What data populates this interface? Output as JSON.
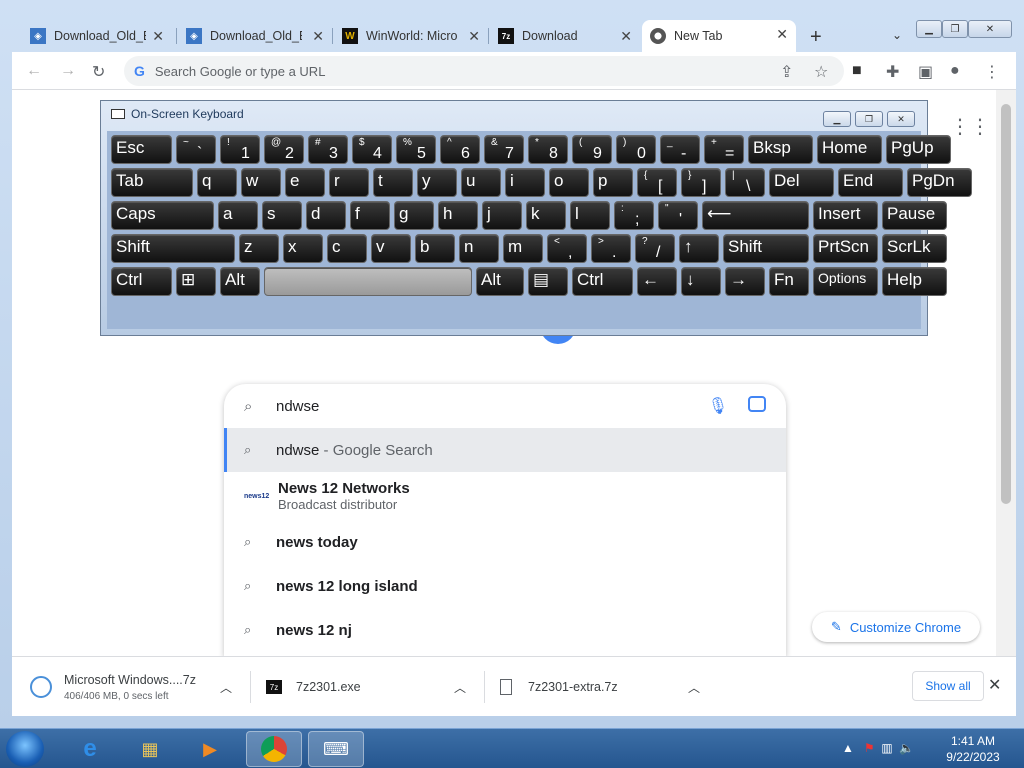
{
  "browser": {
    "tabs": [
      {
        "title": "Download_Old_B",
        "favicon": "globe-doc-icon"
      },
      {
        "title": "Download_Old_B",
        "favicon": "globe-doc-icon"
      },
      {
        "title": "WinWorld: Micro",
        "favicon": "winworld-w-icon"
      },
      {
        "title": "Download",
        "favicon": "7zip-icon"
      },
      {
        "title": "New Tab",
        "favicon": "chrome-icon"
      }
    ],
    "omnibox_placeholder": "Search Google or type a URL"
  },
  "osk": {
    "title": "On-Screen Keyboard",
    "rows": [
      [
        {
          "l": "Esc"
        },
        {
          "t": "~",
          "b": "`"
        },
        {
          "t": "!",
          "b": "1"
        },
        {
          "t": "@",
          "b": "2"
        },
        {
          "t": "#",
          "b": "3"
        },
        {
          "t": "$",
          "b": "4"
        },
        {
          "t": "%",
          "b": "5"
        },
        {
          "t": "^",
          "b": "6"
        },
        {
          "t": "&",
          "b": "7"
        },
        {
          "t": "*",
          "b": "8"
        },
        {
          "t": "(",
          "b": "9"
        },
        {
          "t": ")",
          "b": "0"
        },
        {
          "t": "_",
          "b": "-"
        },
        {
          "t": "+",
          "b": "="
        },
        {
          "l": "Bksp"
        },
        {
          "l": "Home"
        },
        {
          "l": "PgUp"
        }
      ],
      [
        {
          "l": "Tab"
        },
        {
          "l": "q"
        },
        {
          "l": "w"
        },
        {
          "l": "e"
        },
        {
          "l": "r"
        },
        {
          "l": "t"
        },
        {
          "l": "y"
        },
        {
          "l": "u"
        },
        {
          "l": "i"
        },
        {
          "l": "o"
        },
        {
          "l": "p"
        },
        {
          "t": "{",
          "b": "["
        },
        {
          "t": "}",
          "b": "]"
        },
        {
          "t": "|",
          "b": "\\"
        },
        {
          "l": "Del"
        },
        {
          "l": "End"
        },
        {
          "l": "PgDn"
        }
      ],
      [
        {
          "l": "Caps"
        },
        {
          "l": "a"
        },
        {
          "l": "s"
        },
        {
          "l": "d"
        },
        {
          "l": "f"
        },
        {
          "l": "g"
        },
        {
          "l": "h"
        },
        {
          "l": "j"
        },
        {
          "l": "k"
        },
        {
          "l": "l"
        },
        {
          "t": ":",
          "b": ";"
        },
        {
          "t": "\"",
          "b": "'"
        },
        {
          "l": "⟵"
        },
        {
          "l": "Insert"
        },
        {
          "l": "Pause"
        }
      ],
      [
        {
          "l": "Shift"
        },
        {
          "l": "z"
        },
        {
          "l": "x"
        },
        {
          "l": "c"
        },
        {
          "l": "v"
        },
        {
          "l": "b"
        },
        {
          "l": "n"
        },
        {
          "l": "m"
        },
        {
          "t": "<",
          "b": ","
        },
        {
          "t": ">",
          "b": "."
        },
        {
          "t": "?",
          "b": "/"
        },
        {
          "l": "↑"
        },
        {
          "l": "Shift"
        },
        {
          "l": "PrtScn"
        },
        {
          "l": "ScrLk"
        }
      ],
      [
        {
          "l": "Ctrl"
        },
        {
          "l": "⊞"
        },
        {
          "l": "Alt"
        },
        {
          "l": ""
        },
        {
          "l": "Alt"
        },
        {
          "l": "▤"
        },
        {
          "l": "Ctrl"
        },
        {
          "l": "←"
        },
        {
          "l": "↓"
        },
        {
          "l": "→"
        },
        {
          "l": "Fn"
        },
        {
          "l": "Options"
        },
        {
          "l": "Help"
        }
      ]
    ]
  },
  "search": {
    "query": "ndwse",
    "suggestions": [
      {
        "bold": "ndwse",
        "rest": " - Google Search",
        "icon": "search-icon"
      },
      {
        "bold": "News 12 Networks",
        "sub": "Broadcast distributor",
        "icon": "news12-logo"
      },
      {
        "bold": "news today",
        "icon": "search-icon"
      },
      {
        "bold": "news 12 long island",
        "icon": "search-icon"
      },
      {
        "bold": "news 12 nj",
        "icon": "search-icon"
      }
    ]
  },
  "news12_logo_text": "news12",
  "customize_label": "Customize Chrome",
  "downloads": [
    {
      "name": "Microsoft Windows....7z",
      "status": "406/406 MB, 0 secs left"
    },
    {
      "name": "7z2301.exe"
    },
    {
      "name": "7z2301-extra.7z"
    }
  ],
  "show_all_label": "Show all",
  "taskbar": {
    "time": "1:41 AM",
    "date": "9/22/2023"
  }
}
